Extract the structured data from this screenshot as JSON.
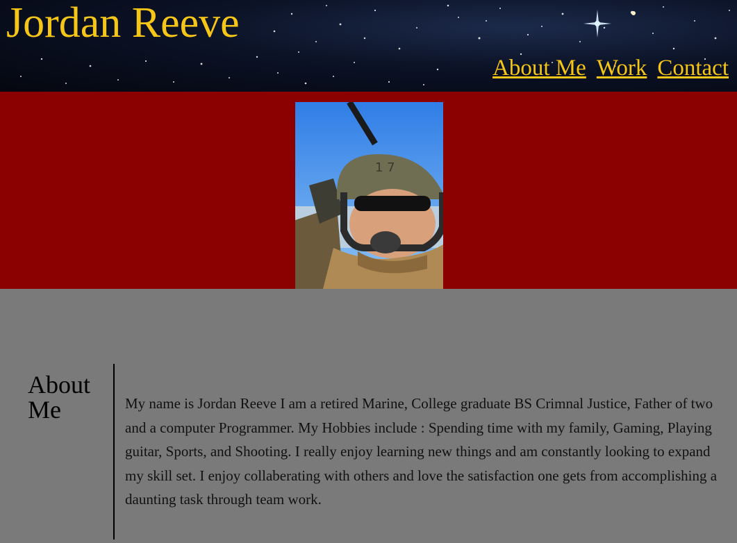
{
  "header": {
    "title": "Jordan Reeve",
    "nav": [
      {
        "label": "About Me"
      },
      {
        "label": "Work"
      },
      {
        "label": "Contact"
      }
    ]
  },
  "hero": {
    "photo_alt": "Jordan Reeve in helmet and sunglasses"
  },
  "about": {
    "heading": "About Me",
    "text": "My name is Jordan Reeve I am a retired Marine, College graduate BS Crimnal Justice, Father of two and a computer Programmer. My Hobbies include : Spending time with my family, Gaming, Playing guitar, Sports, and Shooting. I really enjoy learning new things and am constantly looking to expand my skill set. I enjoy collaberating with others and love the satisfaction one gets from accomplishing a daunting task through team work."
  },
  "colors": {
    "title": "#f5c518",
    "hero_bg": "#8b0000",
    "content_bg": "#7a7a7a"
  }
}
